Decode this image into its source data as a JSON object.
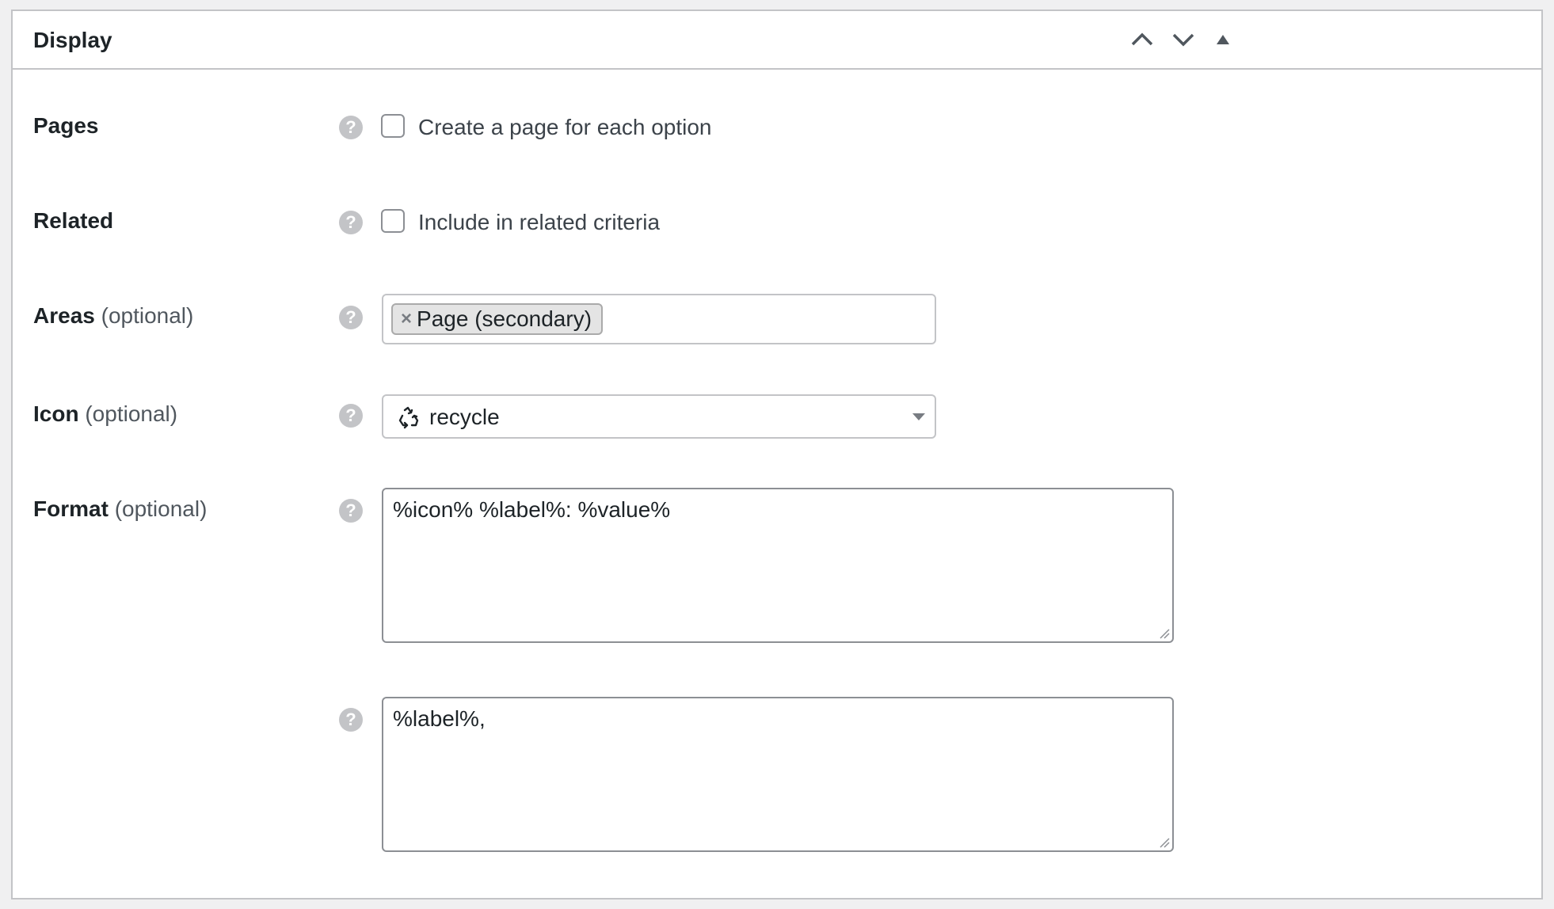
{
  "panel": {
    "title": "Display",
    "controls": {
      "move_up": "chevron-up-icon",
      "move_down": "chevron-down-icon",
      "toggle": "triangle-up-icon"
    }
  },
  "rows": {
    "pages": {
      "label": "Pages",
      "help": "?",
      "checkbox_label": "Create a page for each option",
      "checked": false
    },
    "related": {
      "label": "Related",
      "help": "?",
      "checkbox_label": "Include in related criteria",
      "checked": false
    },
    "areas": {
      "label": "Areas",
      "optional": "(optional)",
      "help": "?",
      "chips": [
        {
          "remove": "×",
          "label": "Page (secondary)"
        }
      ]
    },
    "icon": {
      "label": "Icon",
      "optional": "(optional)",
      "help": "?",
      "selected_icon": "recycle-icon",
      "selected_value": "recycle"
    },
    "format": {
      "label": "Format",
      "optional": "(optional)",
      "help": "?",
      "value": "%icon% %label%: %value%"
    },
    "format_secondary": {
      "help": "?",
      "value": "%label%,"
    }
  },
  "colors": {
    "background": "#f0f0f1",
    "panel": "#ffffff",
    "border": "#c3c4c7",
    "text": "#1d2327",
    "muted": "#50575e",
    "help_badge": "#c3c4c7"
  }
}
